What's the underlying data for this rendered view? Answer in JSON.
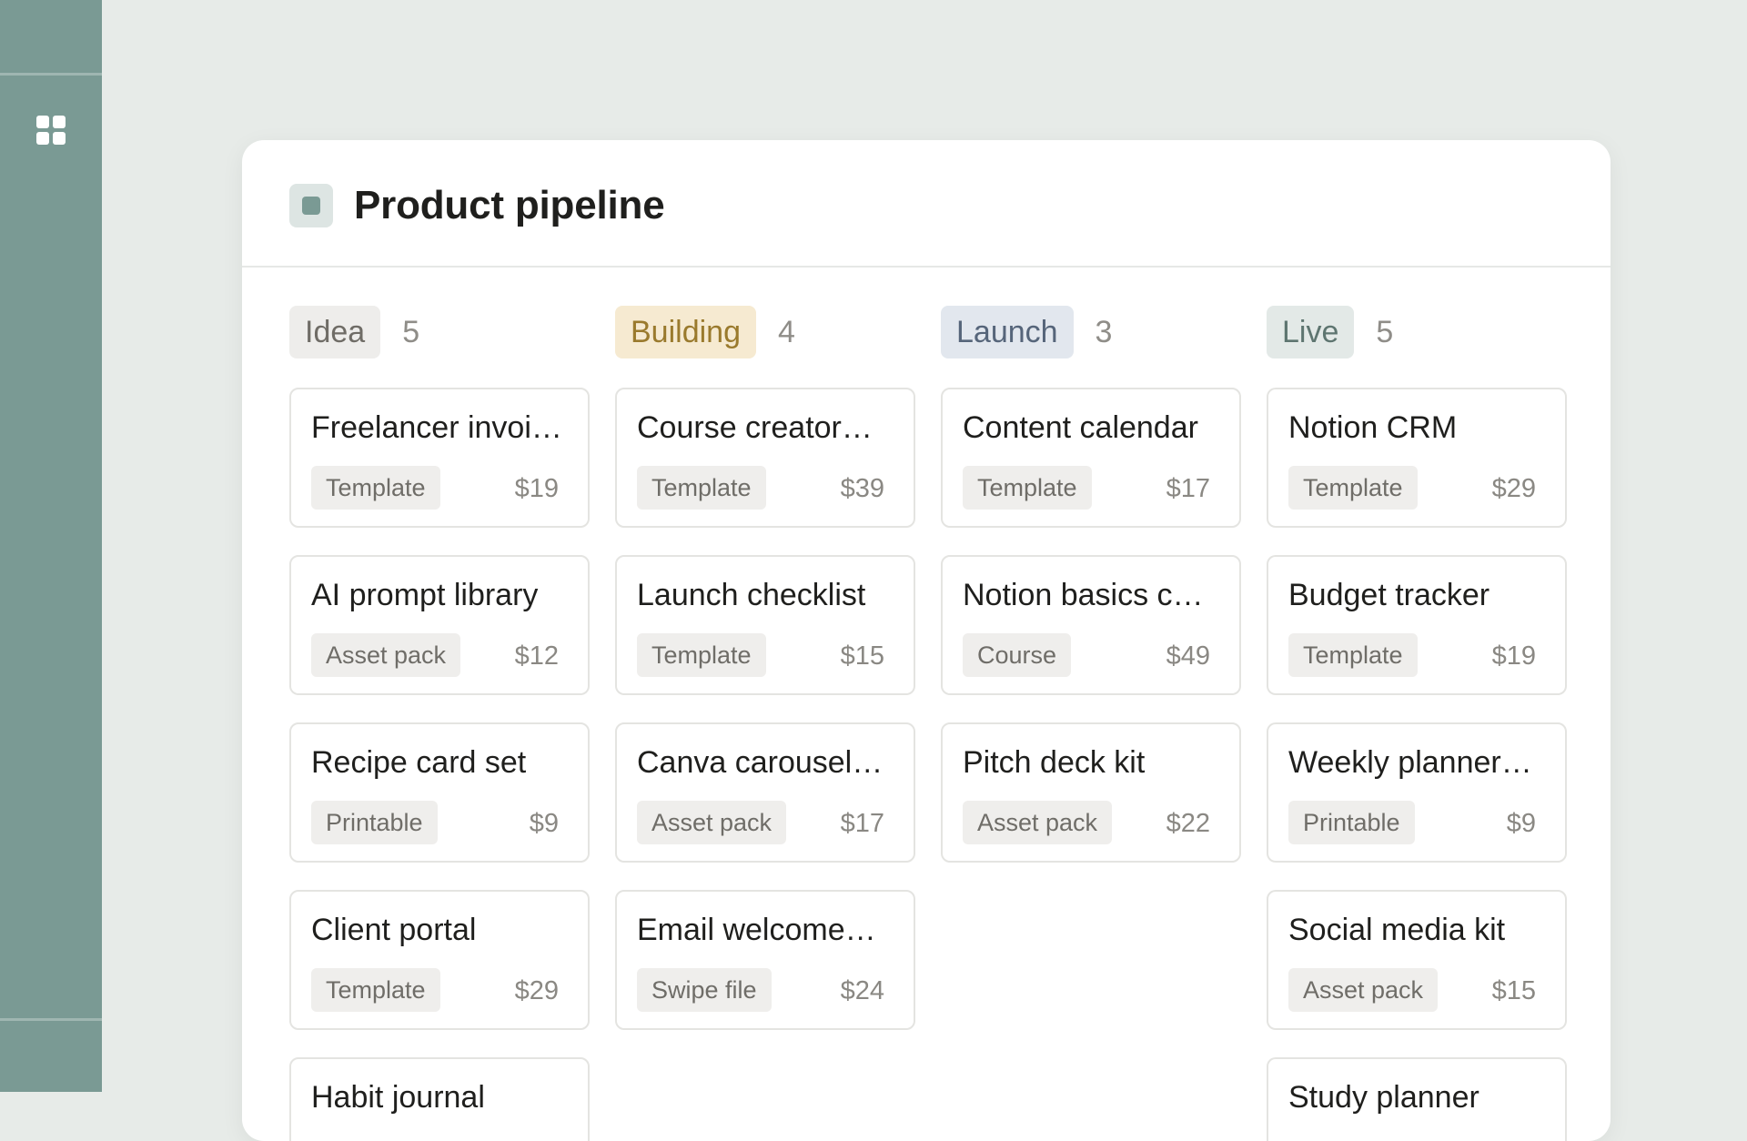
{
  "sidebar": {
    "icon": "grid-icon",
    "color": "#7a9a94"
  },
  "board": {
    "title": "Product pipeline",
    "icon": "database-icon"
  },
  "columns": [
    {
      "label": "Idea",
      "count": "5",
      "tag_bg": "#eeedeb",
      "tag_fg": "#6f6c66",
      "cards": [
        {
          "title": "Freelancer invoi…",
          "type": "Template",
          "price": "$19"
        },
        {
          "title": "AI prompt library",
          "type": "Asset pack",
          "price": "$12"
        },
        {
          "title": "Recipe card set",
          "type": "Printable",
          "price": "$9"
        },
        {
          "title": "Client portal",
          "type": "Template",
          "price": "$29"
        },
        {
          "title": "Habit journal",
          "type": "",
          "price": ""
        }
      ]
    },
    {
      "label": "Building",
      "count": "4",
      "tag_bg": "#f6ead1",
      "tag_fg": "#9a7a2d",
      "cards": [
        {
          "title": "Course creator…",
          "type": "Template",
          "price": "$39"
        },
        {
          "title": "Launch checklist",
          "type": "Template",
          "price": "$15"
        },
        {
          "title": "Canva carousel…",
          "type": "Asset pack",
          "price": "$17"
        },
        {
          "title": "Email welcome…",
          "type": "Swipe file",
          "price": "$24"
        }
      ]
    },
    {
      "label": "Launch",
      "count": "3",
      "tag_bg": "#e2e7ee",
      "tag_fg": "#56657a",
      "cards": [
        {
          "title": "Content calendar",
          "type": "Template",
          "price": "$17"
        },
        {
          "title": "Notion basics c…",
          "type": "Course",
          "price": "$49"
        },
        {
          "title": "Pitch deck kit",
          "type": "Asset pack",
          "price": "$22"
        }
      ]
    },
    {
      "label": "Live",
      "count": "5",
      "tag_bg": "#e3e9e7",
      "tag_fg": "#5e7570",
      "cards": [
        {
          "title": "Notion CRM",
          "type": "Template",
          "price": "$29"
        },
        {
          "title": "Budget tracker",
          "type": "Template",
          "price": "$19"
        },
        {
          "title": "Weekly planner…",
          "type": "Printable",
          "price": "$9"
        },
        {
          "title": "Social media kit",
          "type": "Asset pack",
          "price": "$15"
        },
        {
          "title": "Study planner",
          "type": "",
          "price": ""
        }
      ]
    }
  ]
}
